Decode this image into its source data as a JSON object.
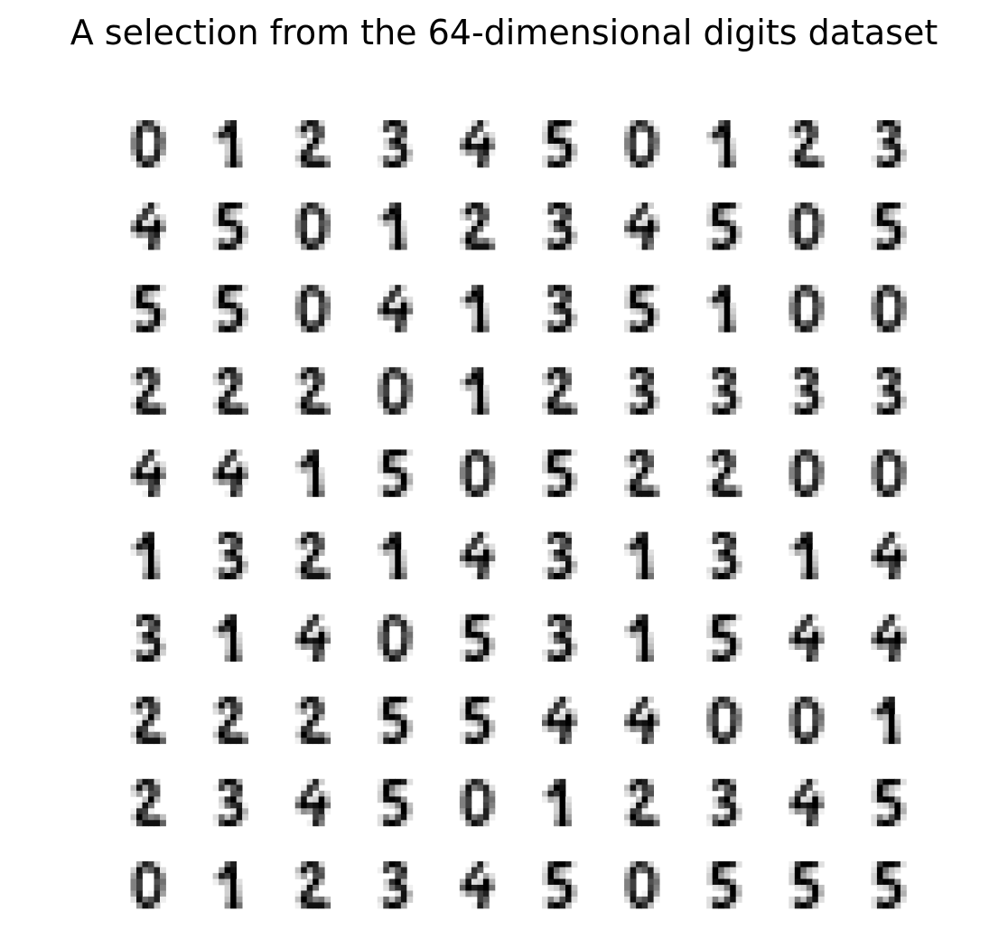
{
  "title": "A selection from the 64-dimensional digits dataset",
  "chart_data": {
    "type": "heatmap",
    "title": "A selection from the 64-dimensional digits dataset",
    "grid": false,
    "colormap": "binary",
    "value_range": [
      0,
      16
    ],
    "image_shape": [
      8,
      8
    ],
    "layout": {
      "rows": 10,
      "cols": 10
    },
    "images": [
      [
        "0",
        "0",
        "0",
        "0",
        "0",
        "0",
        "0",
        "0"
      ]
    ],
    "digits": [
      [
        "0",
        "1",
        "2",
        "3",
        "4",
        "5",
        "0",
        "1",
        "2",
        "3"
      ],
      [
        "4",
        "5",
        "0",
        "1",
        "2",
        "3",
        "4",
        "5",
        "0",
        "5"
      ],
      [
        "5",
        "5",
        "0",
        "4",
        "1",
        "3",
        "5",
        "1",
        "0",
        "0"
      ],
      [
        "2",
        "2",
        "2",
        "0",
        "1",
        "2",
        "3",
        "3",
        "3",
        "3"
      ],
      [
        "4",
        "4",
        "1",
        "5",
        "0",
        "5",
        "2",
        "2",
        "0",
        "0"
      ],
      [
        "1",
        "3",
        "2",
        "1",
        "4",
        "3",
        "1",
        "3",
        "1",
        "4"
      ],
      [
        "3",
        "1",
        "4",
        "0",
        "5",
        "3",
        "1",
        "5",
        "4",
        "4"
      ],
      [
        "2",
        "2",
        "2",
        "5",
        "5",
        "4",
        "4",
        "0",
        "0",
        "1"
      ],
      [
        "2",
        "3",
        "4",
        "5",
        "0",
        "1",
        "2",
        "3",
        "4",
        "5"
      ],
      [
        "0",
        "1",
        "2",
        "3",
        "4",
        "5",
        "0",
        "5",
        "5",
        "5"
      ]
    ]
  }
}
